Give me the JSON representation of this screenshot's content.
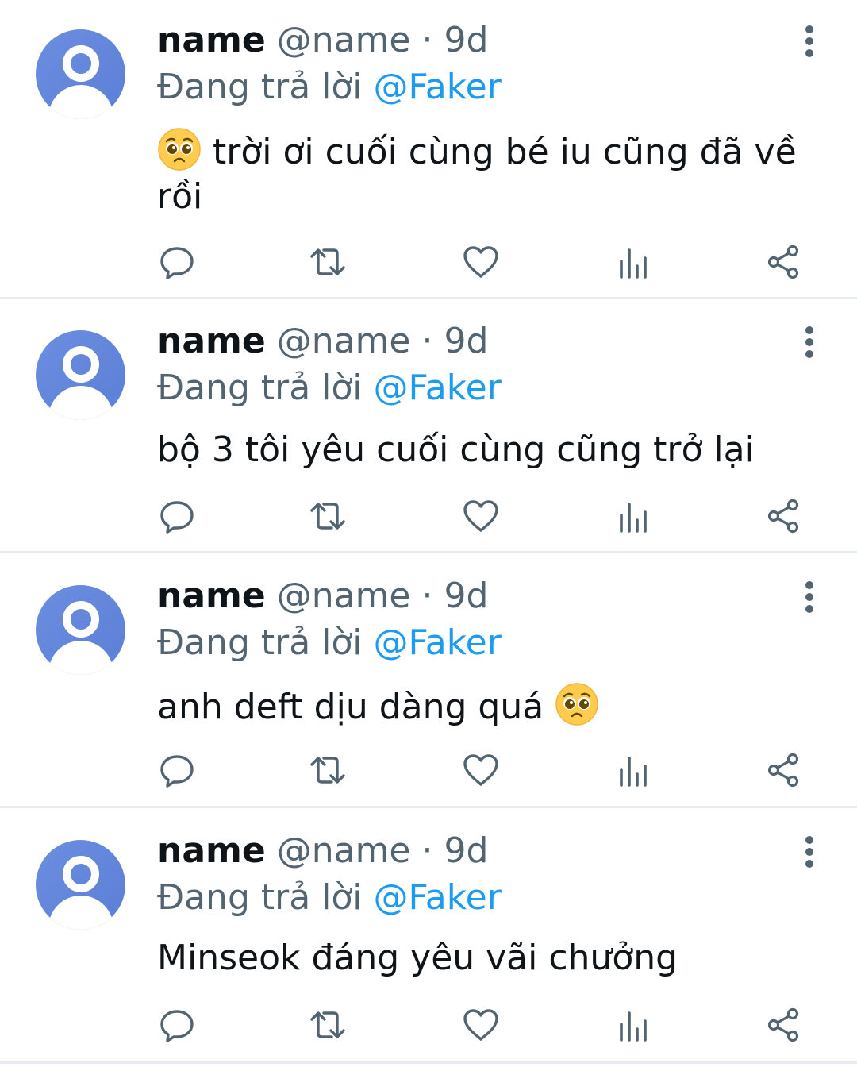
{
  "tweets": [
    {
      "name": "name",
      "handle": "@name",
      "separator": "·",
      "time": "9d",
      "reply_prefix": "Đang trả lời",
      "reply_mention": "@Faker",
      "text_before_emoji": "",
      "emoji": "pleading-face",
      "text_after_emoji": " trời ơi cuối cùng bé iu cũng đã về rồi"
    },
    {
      "name": "name",
      "handle": "@name",
      "separator": "·",
      "time": "9d",
      "reply_prefix": "Đang trả lời",
      "reply_mention": "@Faker",
      "text": "bộ 3 tôi yêu cuối cùng cũng trở lại"
    },
    {
      "name": "name",
      "handle": "@name",
      "separator": "·",
      "time": "9d",
      "reply_prefix": "Đang trả lời",
      "reply_mention": "@Faker",
      "text_before_emoji": "anh deft dịu dàng quá ",
      "emoji": "pleading-face"
    },
    {
      "name": "name",
      "handle": "@name",
      "separator": "·",
      "time": "9d",
      "reply_prefix": "Đang trả lời",
      "reply_mention": "@Faker",
      "text": "Minseok đáng yêu vãi chưởng"
    }
  ],
  "actions": [
    "reply-icon",
    "retweet-icon",
    "like-icon",
    "views-icon",
    "share-icon"
  ],
  "colors": {
    "primary_text": "#0f1419",
    "secondary_text": "#536471",
    "mention": "#1d9bf0",
    "divider": "#e7eaee",
    "avatar": "#5b7fd6"
  }
}
